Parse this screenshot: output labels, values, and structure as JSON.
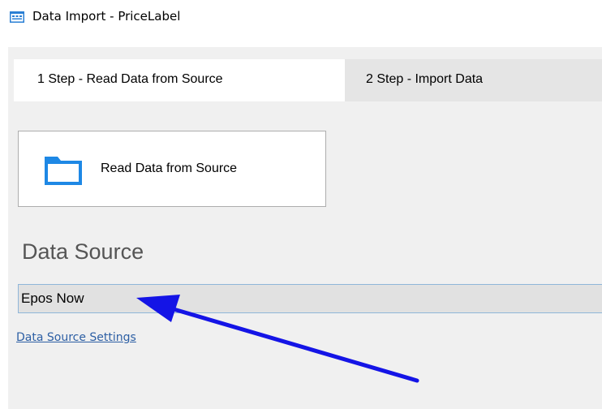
{
  "window": {
    "title": "Data Import - PriceLabel",
    "icon": "app-window-icon"
  },
  "tabs": [
    {
      "label": "1 Step - Read Data from Source",
      "selected": true
    },
    {
      "label": "2 Step - Import Data",
      "selected": false
    }
  ],
  "read_button": {
    "label": "Read Data from Source",
    "icon": "folder-icon"
  },
  "data_source": {
    "heading": "Data Source",
    "value": "Epos Now",
    "settings_link": "Data Source Settings"
  },
  "annotation": {
    "type": "arrow",
    "color": "#1414e6",
    "points_to": "data-source-field"
  },
  "colors": {
    "panel_background": "#f0f0f0",
    "link": "#2d5fa4",
    "field_border": "#8fb6d9"
  }
}
